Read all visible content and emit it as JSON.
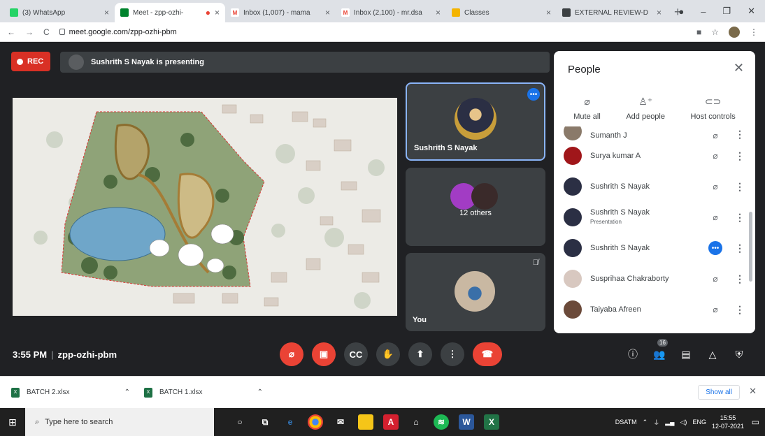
{
  "browser": {
    "tabs": [
      {
        "label": "(3) WhatsApp",
        "favicon_color": "#25d366"
      },
      {
        "label": "Meet - zpp-ozhi-",
        "favicon_color": "#00832d"
      },
      {
        "label": "Inbox (1,007) - mama",
        "favicon_color": "#ea4335"
      },
      {
        "label": "Inbox (2,100) - mr.dsa",
        "favicon_color": "#ea4335"
      },
      {
        "label": "Classes",
        "favicon_color": "#f4b400"
      },
      {
        "label": "EXTERNAL REVIEW-D",
        "favicon_color": "#3c4043"
      }
    ],
    "url": "meet.google.com/zpp-ozhi-pbm"
  },
  "meet": {
    "rec_label": "REC",
    "presenting_text": "Sushrith S Nayak is presenting",
    "tiles": {
      "presenter_name": "Sushrith S Nayak",
      "others_label": "12 others",
      "self_label": "You"
    },
    "people_panel": {
      "title": "People",
      "actions": {
        "mute_all": "Mute all",
        "add_people": "Add people",
        "host_controls": "Host controls"
      },
      "participants": [
        {
          "name": "Sumanth J",
          "sub": "",
          "avatar_color": "#8a7a6a"
        },
        {
          "name": "Surya kumar A",
          "sub": "",
          "avatar_color": "#a0161a"
        },
        {
          "name": "Sushrith S Nayak",
          "sub": "",
          "avatar_color": "#2b2f44"
        },
        {
          "name": "Sushrith S Nayak",
          "sub": "Presentation",
          "avatar_color": "#2b2f44"
        },
        {
          "name": "Sushrith S Nayak",
          "sub": "",
          "avatar_color": "#2b2f44"
        },
        {
          "name": "Susprihaa Chakraborty",
          "sub": "",
          "avatar_color": "#d8c8c0"
        },
        {
          "name": "Taiyaba Afreen",
          "sub": "",
          "avatar_color": "#6b4a3a"
        }
      ]
    },
    "bottom": {
      "time": "3:55 PM",
      "meeting_code": "zpp-ozhi-pbm",
      "participant_count": "16"
    }
  },
  "downloads": {
    "items": [
      "BATCH 2.xlsx",
      "BATCH 1.xlsx"
    ],
    "show_all": "Show all"
  },
  "taskbar": {
    "search_placeholder": "Type here to search",
    "tray_label": "DSATM",
    "lang": "ENG",
    "clock_time": "15:55",
    "clock_date": "12-07-2021"
  }
}
